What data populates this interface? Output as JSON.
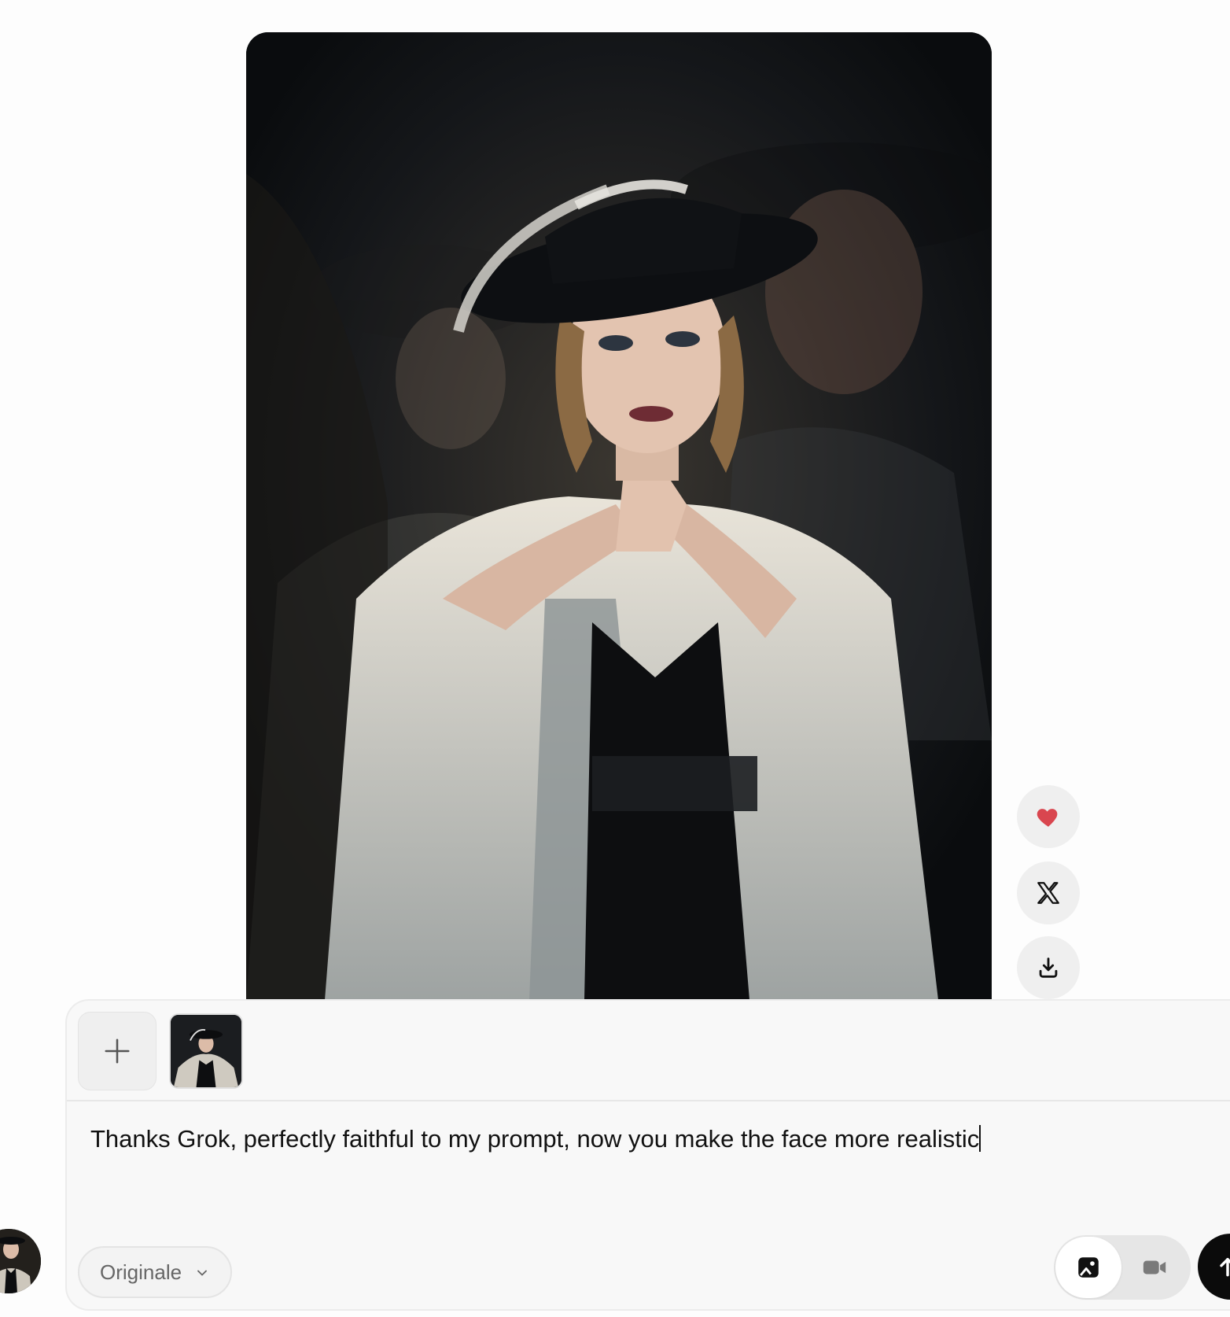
{
  "main_image": {
    "alt": ""
  },
  "side_actions": [
    {
      "name": "like",
      "icon": "heart-icon",
      "color": "#d9464f"
    },
    {
      "name": "share-x",
      "icon": "x-logo-icon"
    },
    {
      "name": "download",
      "icon": "download-icon"
    }
  ],
  "composer": {
    "add_icon": "plus-icon",
    "prompt_text": "Thanks Grok, perfectly faithful to my prompt, now you make the face more realistic",
    "style_select": {
      "selected": "Originale",
      "icon": "chevron-down-icon"
    },
    "mode_toggle": {
      "active": "image",
      "options": [
        "image",
        "video"
      ]
    },
    "send_icon": "arrow-up-icon"
  },
  "colors": {
    "accent_heart": "#d9464f",
    "send_bg": "#0b0b0b"
  }
}
